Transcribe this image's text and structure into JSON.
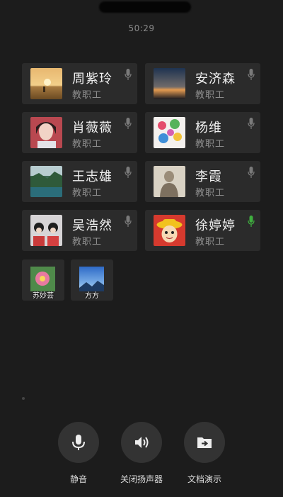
{
  "call": {
    "timer": "50:29"
  },
  "participants": [
    {
      "name": "周紫玲",
      "role": "教职工",
      "mic_color": "#7a7a7a"
    },
    {
      "name": "安济森",
      "role": "教职工",
      "mic_color": "#7a7a7a"
    },
    {
      "name": "肖薇薇",
      "role": "教职工",
      "mic_color": "#7a7a7a"
    },
    {
      "name": "杨维",
      "role": "教职工",
      "mic_color": "#7a7a7a"
    },
    {
      "name": "王志雄",
      "role": "教职工",
      "mic_color": "#7a7a7a"
    },
    {
      "name": "李霞",
      "role": "教职工",
      "mic_color": "#7a7a7a"
    },
    {
      "name": "吴浩然",
      "role": "教职工",
      "mic_color": "#7a7a7a"
    },
    {
      "name": "徐婷婷",
      "role": "教职工",
      "mic_color": "#3fae3f"
    }
  ],
  "small_participants": [
    {
      "name": "苏妙芸"
    },
    {
      "name": "方方"
    }
  ],
  "controls": {
    "mute_label": "静音",
    "speaker_label": "关闭扬声器",
    "share_doc_label": "文档演示"
  }
}
